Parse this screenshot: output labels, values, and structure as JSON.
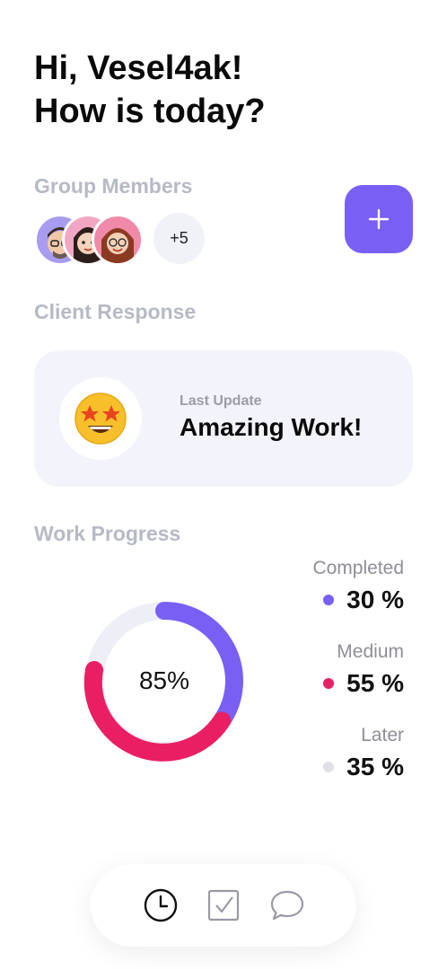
{
  "greeting": {
    "line1": "Hi, Vesel4ak!",
    "line2": "How is today?"
  },
  "group_members": {
    "label": "Group Members",
    "avatars": [
      {
        "name": "member-avatar-1",
        "bg": "#a89cf0"
      },
      {
        "name": "member-avatar-2",
        "bg": "#f1a7c4"
      },
      {
        "name": "member-avatar-3",
        "bg": "#f08aa8"
      }
    ],
    "more_count": "+5",
    "add_button_icon": "plus-icon",
    "accent": "#7a5ff5"
  },
  "client_response": {
    "label": "Client Response",
    "last_update_label": "Last Update",
    "message": "Amazing Work!",
    "emoji_icon": "star-struck-emoji-icon"
  },
  "work_progress": {
    "label": "Work Progress",
    "total": "85%",
    "items": [
      {
        "label": "Completed",
        "value": "30 %",
        "color": "#7a5ff5"
      },
      {
        "label": "Medium",
        "value": "55 %",
        "color": "#e91e63"
      },
      {
        "label": "Later",
        "value": "35 %",
        "color": "#e0e0e6"
      }
    ]
  },
  "nav": {
    "items": [
      {
        "icon": "clock-icon",
        "active": true
      },
      {
        "icon": "checkbox-icon",
        "active": false
      },
      {
        "icon": "chat-bubble-icon",
        "active": false
      }
    ]
  }
}
